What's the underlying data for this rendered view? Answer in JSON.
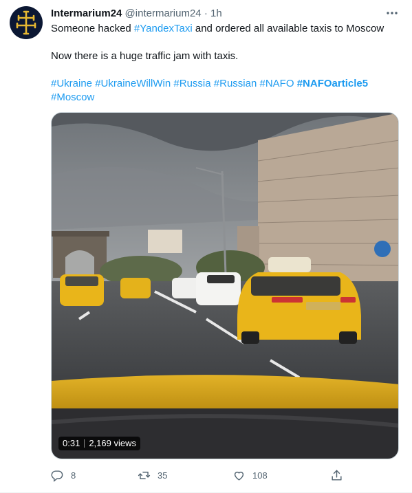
{
  "tweet": {
    "author_name": "Intermarium24",
    "author_handle": "@intermarium24",
    "separator": "·",
    "time": "1h",
    "line1_prefix": "Someone hacked ",
    "line1_hashtag": "#YandexTaxi",
    "line1_suffix": " and ordered all available taxis to Moscow",
    "line2": "Now there is a huge traffic jam with taxis.",
    "hashtags": [
      "#Ukraine",
      "#UkraineWillWin",
      "#Russia",
      "#Russian",
      "#NAFO",
      "#NAFOarticle5",
      "#Moscow"
    ],
    "bold_hashtag": "#NAFOarticle5"
  },
  "video": {
    "duration": "0:31",
    "views": "2,169 views"
  },
  "actions": {
    "replies": "8",
    "retweets": "35",
    "likes": "108"
  },
  "colors": {
    "link": "#1d9bf0",
    "secondary": "#536471",
    "taxi": "#e9b51a"
  },
  "icons": [
    "more-icon",
    "reply-icon",
    "retweet-icon",
    "like-icon",
    "share-icon",
    "cross-avatar-icon"
  ]
}
